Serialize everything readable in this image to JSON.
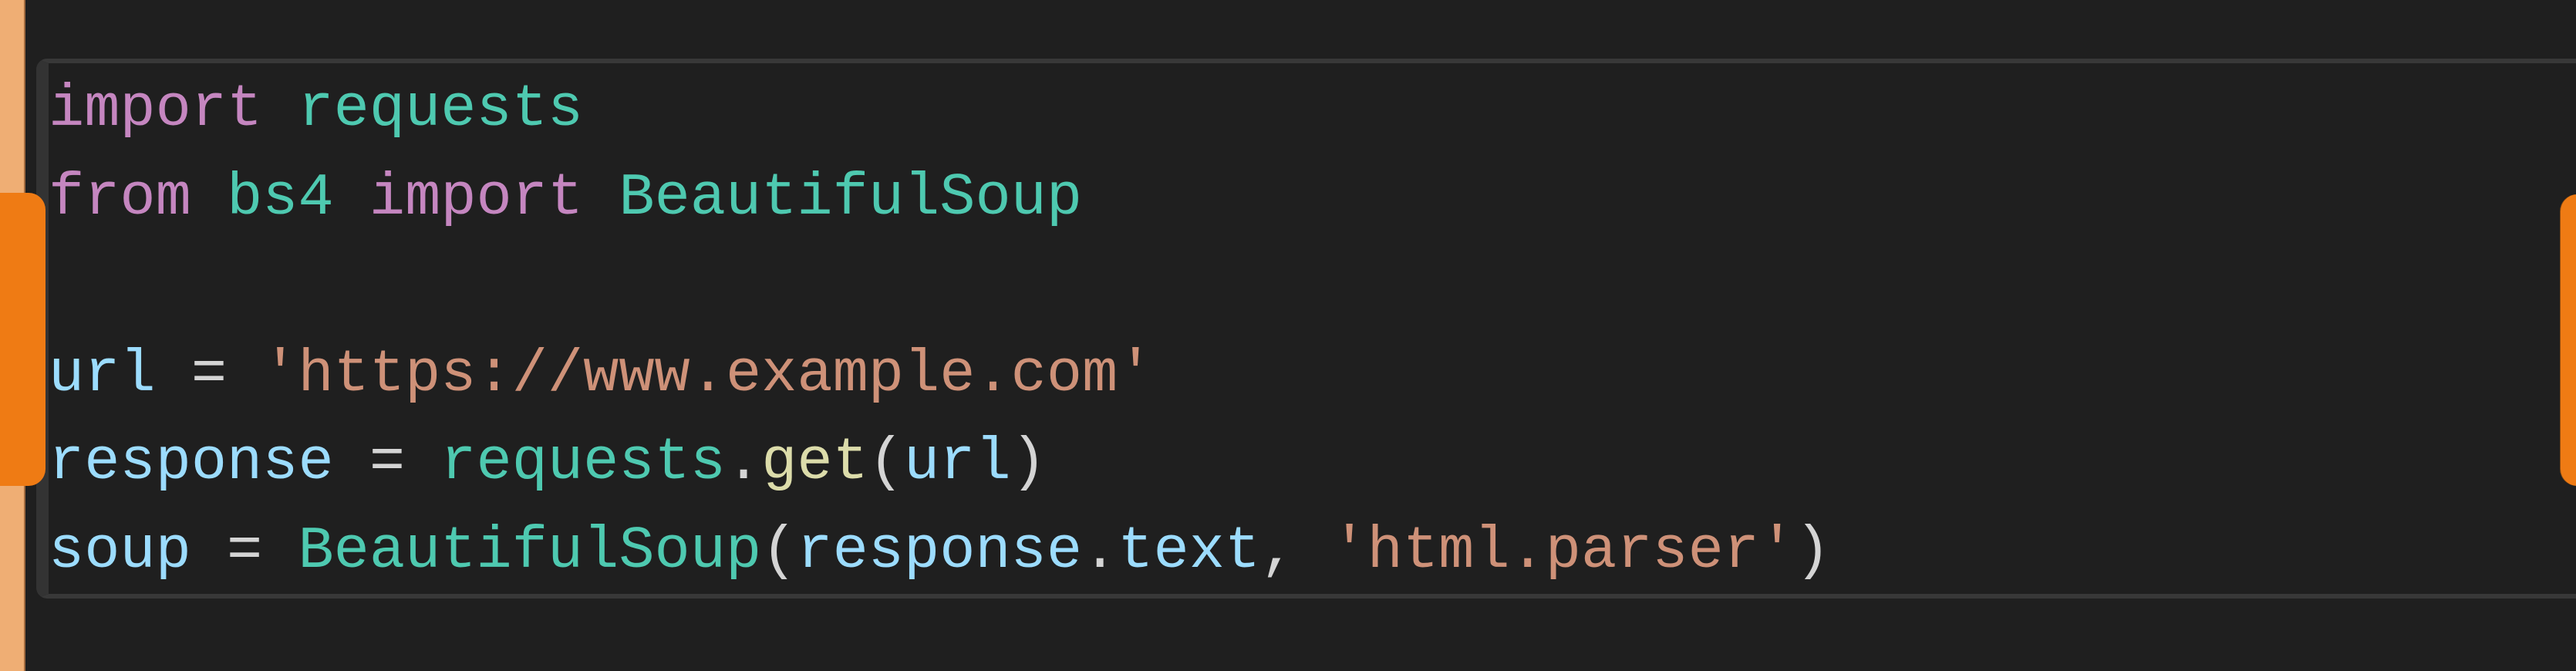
{
  "editor": {
    "language": "python",
    "colors": {
      "background": "#1f1f1f",
      "keyword": "#c586c0",
      "module_class": "#4ec9b0",
      "variable": "#9cdcfe",
      "string": "#ce9178",
      "function": "#dcdcaa",
      "operator": "#d4d4d4",
      "gutter_marker": "#efae74",
      "resize_handle": "#ef7b14"
    },
    "lines": [
      {
        "tokens": [
          {
            "t": "import",
            "c": "kw"
          },
          {
            "t": " ",
            "c": "op"
          },
          {
            "t": "requests",
            "c": "mod"
          }
        ]
      },
      {
        "tokens": [
          {
            "t": "from",
            "c": "kw"
          },
          {
            "t": " ",
            "c": "op"
          },
          {
            "t": "bs4",
            "c": "mod"
          },
          {
            "t": " ",
            "c": "op"
          },
          {
            "t": "import",
            "c": "kw"
          },
          {
            "t": " ",
            "c": "op"
          },
          {
            "t": "BeautifulSoup",
            "c": "mod"
          }
        ]
      },
      {
        "tokens": []
      },
      {
        "tokens": [
          {
            "t": "url",
            "c": "var"
          },
          {
            "t": " = ",
            "c": "op"
          },
          {
            "t": "'https://www.example.com'",
            "c": "str"
          }
        ]
      },
      {
        "tokens": [
          {
            "t": "response",
            "c": "var"
          },
          {
            "t": " = ",
            "c": "op"
          },
          {
            "t": "requests",
            "c": "mod"
          },
          {
            "t": ".",
            "c": "op"
          },
          {
            "t": "get",
            "c": "fn"
          },
          {
            "t": "(",
            "c": "op"
          },
          {
            "t": "url",
            "c": "var"
          },
          {
            "t": ")",
            "c": "op"
          }
        ]
      },
      {
        "tokens": [
          {
            "t": "soup",
            "c": "var"
          },
          {
            "t": " = ",
            "c": "op"
          },
          {
            "t": "BeautifulSoup",
            "c": "mod"
          },
          {
            "t": "(",
            "c": "op"
          },
          {
            "t": "response",
            "c": "var"
          },
          {
            "t": ".",
            "c": "op"
          },
          {
            "t": "text",
            "c": "var"
          },
          {
            "t": ", ",
            "c": "op"
          },
          {
            "t": "'html.parser'",
            "c": "str"
          },
          {
            "t": ")",
            "c": "op"
          }
        ]
      }
    ]
  }
}
